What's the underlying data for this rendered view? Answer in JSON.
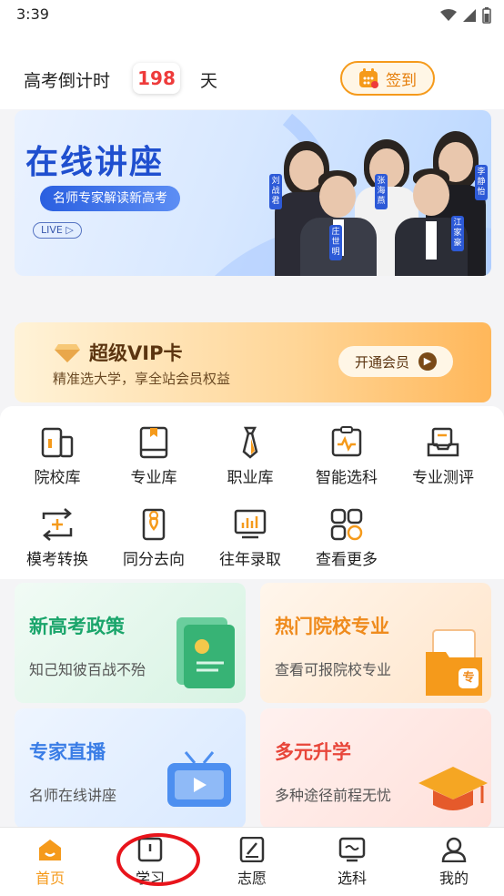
{
  "status_bar": {
    "time": "3:39"
  },
  "header": {
    "countdown_label": "高考倒计时",
    "countdown_days": "198",
    "countdown_unit": "天",
    "checkin_label": "签到"
  },
  "banner": {
    "title": "在线讲座",
    "subtitle": "名师专家解读新高考",
    "live_badge": "LIVE",
    "lecturers": [
      "刘战君",
      "庄世明",
      "张海燕",
      "李静怡",
      "江家豪"
    ]
  },
  "vip": {
    "title": "超级VIP卡",
    "description": "精准选大学，享全站会员权益",
    "button_label": "开通会员"
  },
  "grid_items": [
    {
      "label": "院校库",
      "icon": "college-building-icon"
    },
    {
      "label": "专业库",
      "icon": "book-icon"
    },
    {
      "label": "职业库",
      "icon": "tie-icon"
    },
    {
      "label": "智能选科",
      "icon": "clipboard-pulse-icon"
    },
    {
      "label": "专业测评",
      "icon": "test-tray-icon"
    },
    {
      "label": "模考转换",
      "icon": "convert-icon"
    },
    {
      "label": "同分去向",
      "icon": "phone-location-icon"
    },
    {
      "label": "往年录取",
      "icon": "bar-chart-monitor-icon"
    },
    {
      "label": "查看更多",
      "icon": "more-grid-icon"
    }
  ],
  "cards": [
    {
      "title": "新高考政策",
      "subtitle": "知己知彼百战不殆"
    },
    {
      "title": "热门院校专业",
      "subtitle": "查看可报院校专业",
      "badge": "专"
    },
    {
      "title": "专家直播",
      "subtitle": "名师在线讲座"
    },
    {
      "title": "多元升学",
      "subtitle": "多种途径前程无忧"
    }
  ],
  "tabs": [
    {
      "label": "首页",
      "icon": "home-icon",
      "active": true
    },
    {
      "label": "学习",
      "icon": "book-open-icon",
      "active": false
    },
    {
      "label": "志愿",
      "icon": "notebook-pen-icon",
      "active": false
    },
    {
      "label": "选科",
      "icon": "screen-chart-icon",
      "active": false
    },
    {
      "label": "我的",
      "icon": "user-icon",
      "active": false
    }
  ],
  "colors": {
    "accent_orange": "#f59a1b",
    "countdown_red": "#ee3b3b",
    "banner_blue": "#1f4fcf",
    "policy_green": "#1aa56b",
    "hot_orange": "#ef8b1d",
    "live_blue": "#3a7de6",
    "multi_red": "#e8463a"
  }
}
